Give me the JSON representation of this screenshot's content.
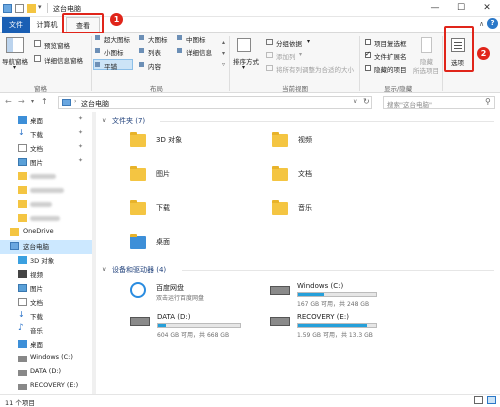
{
  "window": {
    "title": "这台电脑"
  },
  "tabs": {
    "file": "文件",
    "computer": "计算机",
    "view": "查看"
  },
  "ribbon": {
    "nav_pane": "导航窗格",
    "preview_pane": "预览窗格",
    "details_pane": "详细信息窗格",
    "group_panes": "窗格",
    "layout_items": [
      "超大图标",
      "大图标",
      "中图标",
      "小图标",
      "列表",
      "详细信息",
      "平铺",
      "内容"
    ],
    "group_layout": "布局",
    "sort_by": "排序方式",
    "group_by": "分组依据",
    "add_column": "添加列",
    "fit_columns": "将所有列调整为合适的大小",
    "group_current": "当前视图",
    "item_checkbox": "项目复选框",
    "file_ext": "文件扩展名",
    "hidden_items": "隐藏的项目",
    "hide_selected": "隐藏",
    "hide_selected_sub": "所选项目",
    "group_showhide": "显示/隐藏",
    "options": "选项"
  },
  "callouts": {
    "one": "1",
    "two": "2"
  },
  "address": {
    "path": "这台电脑",
    "search_placeholder": "搜索\"这台电脑\""
  },
  "nav": {
    "items": [
      "桌面",
      "下载",
      "文档",
      "图片",
      "OneDrive",
      "这台电脑",
      "3D 对象",
      "视频",
      "图片",
      "文档",
      "下载",
      "音乐",
      "桌面",
      "Windows (C:)",
      "DATA (D:)",
      "RECOVERY (E:)"
    ]
  },
  "folders_section": {
    "title": "文件夹 (7)",
    "items": [
      "3D 对象",
      "视频",
      "图片",
      "文档",
      "下载",
      "音乐",
      "桌面"
    ]
  },
  "devices_section": {
    "title": "设备和驱动器 (4)",
    "baidu": {
      "name": "百度网盘",
      "sub": "双击运行百度网盘"
    },
    "drives": [
      {
        "name": "Windows (C:)",
        "free": "167 GB 可用，共 248 GB",
        "used_fraction": 0.33
      },
      {
        "name": "DATA (D:)",
        "free": "604 GB 可用，共 668 GB",
        "used_fraction": 0.1
      },
      {
        "name": "RECOVERY (E:)",
        "free": "1.59 GB 可用，共 13.3 GB",
        "used_fraction": 0.88
      }
    ]
  },
  "status": {
    "count": "11 个项目"
  },
  "colors": {
    "accent": "#1a5fb4",
    "highlight": "#e0251a",
    "drive": "#26a0da",
    "folder": "#f4c542"
  }
}
